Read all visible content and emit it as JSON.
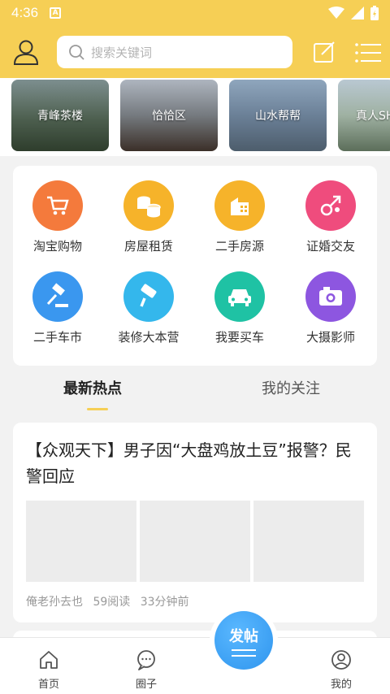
{
  "status": {
    "time": "4:36",
    "notif_icon": "A"
  },
  "header": {
    "search_placeholder": "搜索关键词"
  },
  "banners": [
    {
      "label": "青峰茶楼"
    },
    {
      "label": "恰恰区"
    },
    {
      "label": "山水帮帮"
    },
    {
      "label": "真人SH"
    }
  ],
  "categories": [
    {
      "label": "淘宝购物",
      "icon": "shopping-cart-icon",
      "color": "#f47a3c"
    },
    {
      "label": "房屋租赁",
      "icon": "coins-icon",
      "color": "#f6b32a"
    },
    {
      "label": "二手房源",
      "icon": "building-icon",
      "color": "#f6b32a"
    },
    {
      "label": "证婚交友",
      "icon": "gender-icon",
      "color": "#ef4c7d"
    },
    {
      "label": "二手车市",
      "icon": "gavel-icon",
      "color": "#3a97ef"
    },
    {
      "label": "装修大本营",
      "icon": "paint-roller-icon",
      "color": "#34b7ec"
    },
    {
      "label": "我要买车",
      "icon": "car-icon",
      "color": "#1fc2a4"
    },
    {
      "label": "大摄影师",
      "icon": "camera-icon",
      "color": "#8d56e0"
    }
  ],
  "tabs": {
    "active": "最新热点",
    "inactive": "我的关注"
  },
  "article": {
    "title": "【众观天下】男子因“大盘鸡放土豆”报警？民警回应",
    "author": "俺老孙去也",
    "reads": "59阅读",
    "time": "33分钟前"
  },
  "nav": {
    "home": "首页",
    "circle": "圈子",
    "post": "发帖",
    "mine": "我的"
  }
}
